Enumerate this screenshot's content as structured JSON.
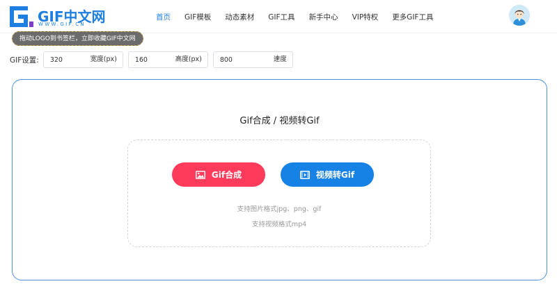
{
  "brand": {
    "name": "GIF中文网",
    "url": "WWW.GIF.CN",
    "color": "#1e7fe0"
  },
  "nav": {
    "items": [
      {
        "label": "首页",
        "active": true
      },
      {
        "label": "GIF模板",
        "active": false
      },
      {
        "label": "动态素材",
        "active": false
      },
      {
        "label": "GIF工具",
        "active": false
      },
      {
        "label": "新手中心",
        "active": false
      },
      {
        "label": "VIP特权",
        "active": false
      },
      {
        "label": "更多GIF工具",
        "active": false
      }
    ]
  },
  "tip": {
    "text": "拖动LOGO到书签栏，立即收藏GIF中文网"
  },
  "settings": {
    "label": "GIF设置:",
    "width": {
      "value": "320",
      "unit": "宽度(px)"
    },
    "height": {
      "value": "160",
      "unit": "高度(px)"
    },
    "speed": {
      "value": "800",
      "unit": "速度"
    }
  },
  "main": {
    "title": "Gif合成 / 视频转Gif",
    "gif_button_label": "Gif合成",
    "video_button_label": "视频转Gif",
    "hint_images": "支持图片格式jpg、png、gif",
    "hint_video": "支持视频格式mp4"
  },
  "colors": {
    "accent": "#1e7fe0",
    "gif_button": "#ff3b5c",
    "video_button": "#1782e6",
    "card_border": "#4a90e2"
  }
}
